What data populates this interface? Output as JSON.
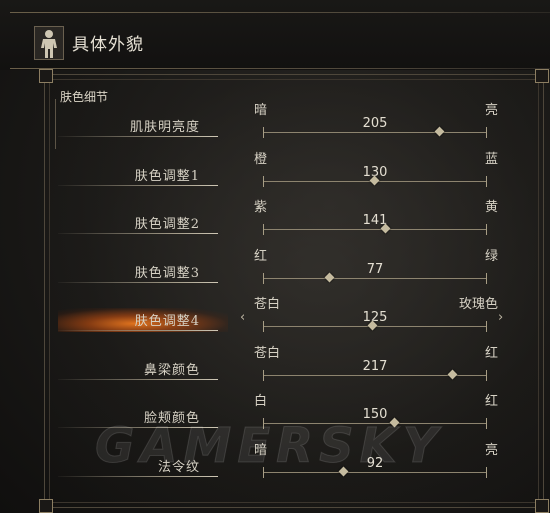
{
  "header": {
    "title": "具体外貌",
    "icon": "body-figure-icon"
  },
  "section": {
    "title": "肤色细节"
  },
  "rows": [
    {
      "label": "肌肤明亮度",
      "left": "暗",
      "right": "亮",
      "value": 205,
      "position": 0.79
    },
    {
      "label": "肤色调整1",
      "left": "橙",
      "right": "蓝",
      "value": 130,
      "position": 0.5
    },
    {
      "label": "肤色调整2",
      "left": "紫",
      "right": "黄",
      "value": 141,
      "position": 0.55
    },
    {
      "label": "肤色调整3",
      "left": "红",
      "right": "绿",
      "value": 77,
      "position": 0.3
    },
    {
      "label": "肤色调整4",
      "left": "苍白",
      "right": "玫瑰色",
      "value": 125,
      "position": 0.49,
      "selected": true
    },
    {
      "label": "鼻梁颜色",
      "left": "苍白",
      "right": "红",
      "value": 217,
      "position": 0.85
    },
    {
      "label": "脸颊颜色",
      "left": "白",
      "right": "红",
      "value": 150,
      "position": 0.59
    },
    {
      "label": "法令纹",
      "left": "暗",
      "right": "亮",
      "value": 92,
      "position": 0.36
    }
  ],
  "selector_arrows": {
    "left": "‹",
    "right": "›"
  },
  "watermark": "GAMERSKY",
  "colors": {
    "accent": "#e8761e",
    "text": "#d8d3c6",
    "track": "#8d846f"
  }
}
